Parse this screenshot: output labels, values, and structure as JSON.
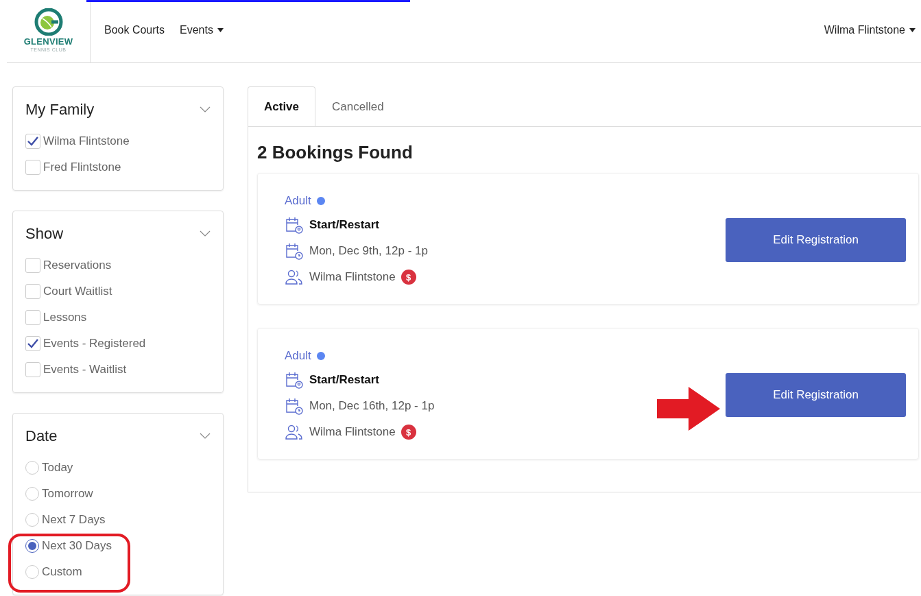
{
  "header": {
    "logo": {
      "name": "GLENVIEW",
      "subtitle": "TENNIS CLUB"
    },
    "nav": [
      {
        "label": "Book Courts",
        "dropdown": false
      },
      {
        "label": "Events",
        "dropdown": true
      }
    ],
    "user": {
      "label": "Wilma Flintstone"
    }
  },
  "filters": [
    {
      "title": "My Family",
      "kind": "checkbox",
      "options": [
        {
          "label": "Wilma Flintstone",
          "checked": true
        },
        {
          "label": "Fred Flintstone",
          "checked": false
        }
      ]
    },
    {
      "title": "Show",
      "kind": "checkbox",
      "options": [
        {
          "label": "Reservations",
          "checked": false
        },
        {
          "label": "Court Waitlist",
          "checked": false
        },
        {
          "label": "Lessons",
          "checked": false
        },
        {
          "label": "Events - Registered",
          "checked": true
        },
        {
          "label": "Events - Waitlist",
          "checked": false
        }
      ]
    },
    {
      "title": "Date",
      "kind": "radio",
      "options": [
        {
          "label": "Today",
          "selected": false
        },
        {
          "label": "Tomorrow",
          "selected": false
        },
        {
          "label": "Next 7 Days",
          "selected": false
        },
        {
          "label": "Next 30 Days",
          "selected": true
        },
        {
          "label": "Custom",
          "selected": false
        }
      ]
    }
  ],
  "tabs": [
    {
      "label": "Active",
      "selected": true
    },
    {
      "label": "Cancelled",
      "selected": false
    }
  ],
  "heading": "2 Bookings Found",
  "bookings": [
    {
      "category": "Adult",
      "title": "Start/Restart",
      "when": "Mon, Dec 9th, 12p - 1p",
      "member": "Wilma Flintstone",
      "payment_badge": "$",
      "action": "Edit Registration"
    },
    {
      "category": "Adult",
      "title": "Start/Restart",
      "when": "Mon, Dec 16th, 12p - 1p",
      "member": "Wilma Flintstone",
      "payment_badge": "$",
      "action": "Edit Registration"
    }
  ]
}
